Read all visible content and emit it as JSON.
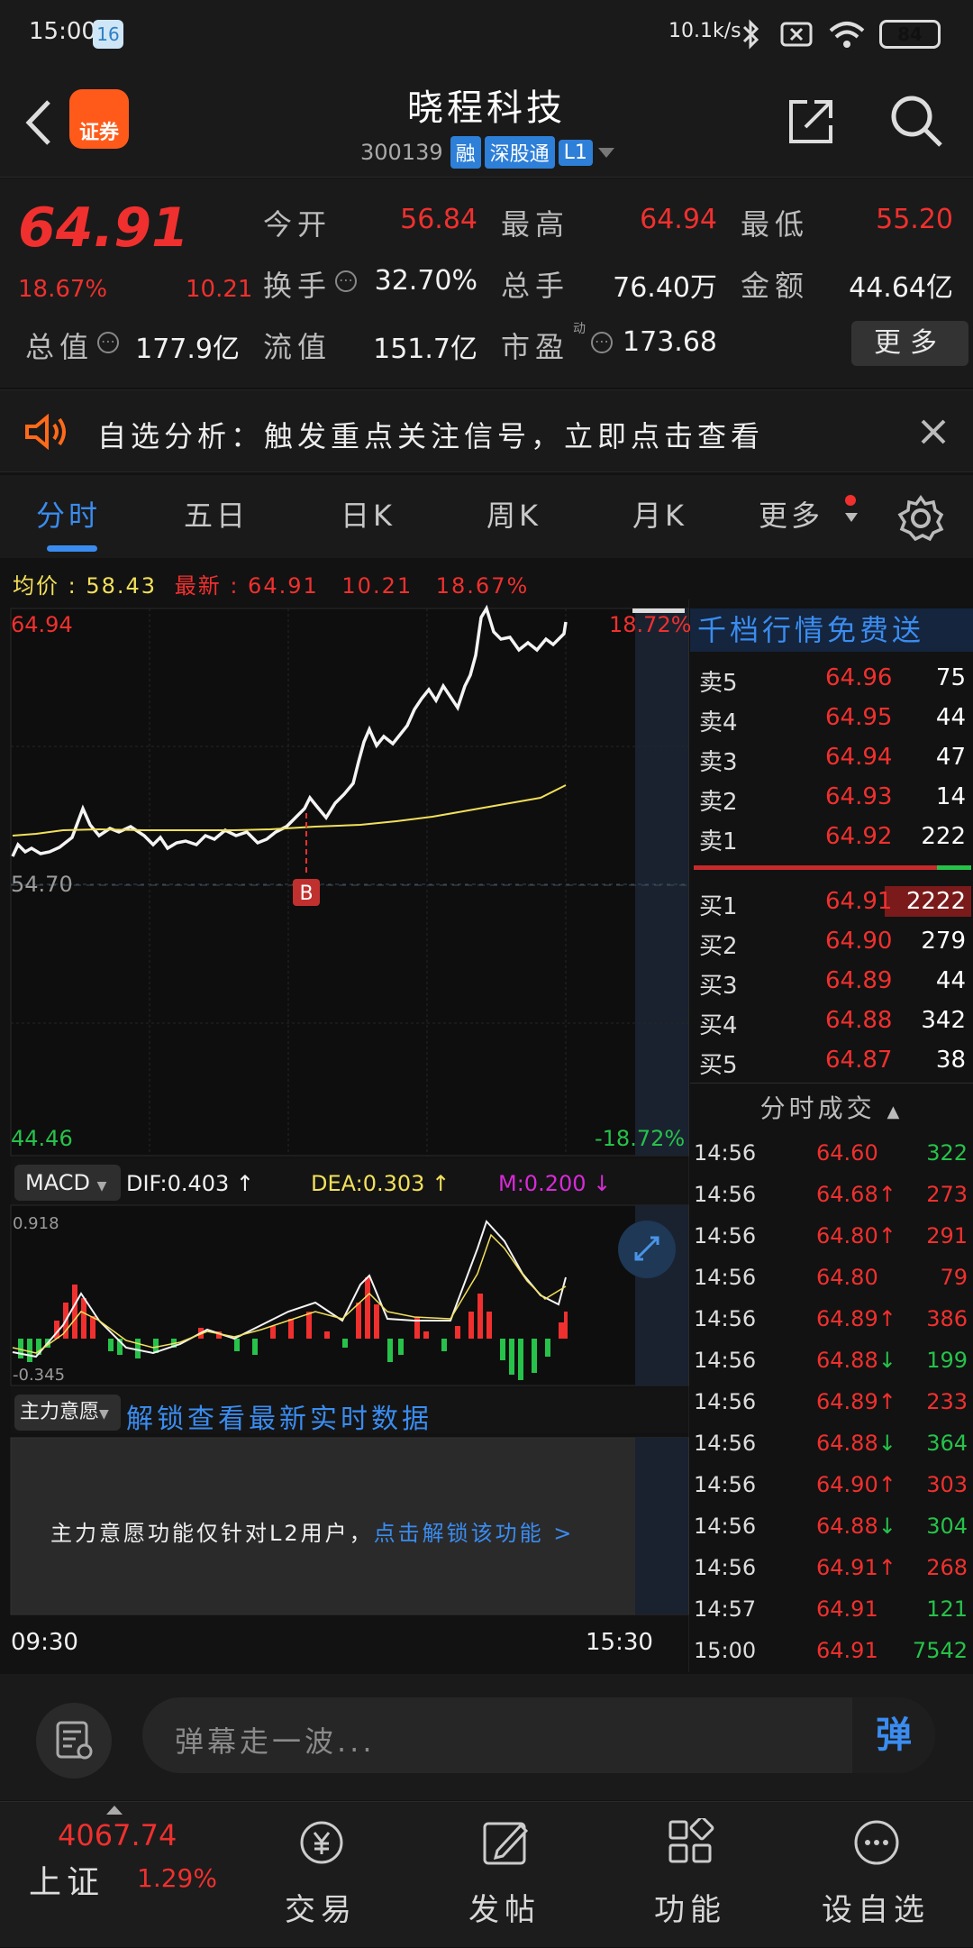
{
  "status_bar": {
    "time": "15:00",
    "notif_count": "16",
    "net_speed": "10.1k/s",
    "battery": "84"
  },
  "header": {
    "title": "晓程科技",
    "code": "300139",
    "tags": [
      "融",
      "深股通",
      "L1"
    ],
    "logo_text": "证券"
  },
  "quote": {
    "price": "64.91",
    "change_pct": "18.67%",
    "change_amt": "10.21",
    "fields": {
      "open_label": "今开",
      "open": "56.84",
      "high_label": "最高",
      "high": "64.94",
      "low_label": "最低",
      "low": "55.20",
      "turnover_label": "换手",
      "turnover": "32.70%",
      "volume_label": "总手",
      "volume": "76.40万",
      "amount_label": "金额",
      "amount": "44.64亿",
      "mcap_label": "总值",
      "mcap": "177.9亿",
      "float_label": "流值",
      "float": "151.7亿",
      "pe_label": "市盈",
      "pe_sup": "动",
      "pe": "173.68"
    },
    "more_label": "更多"
  },
  "banner": {
    "text": "自选分析：触发重点关注信号，立即点击查看"
  },
  "tabs": [
    "分时",
    "五日",
    "日K",
    "周K",
    "月K",
    "更多"
  ],
  "avg_info": {
    "avg_label": "均价",
    "avg": "58.43",
    "last_label": "最新",
    "last": "64.91",
    "chg": "10.21",
    "pct": "18.67%"
  },
  "chart": {
    "max_price": "64.94",
    "max_pct": "18.72%",
    "ref_price": "54.70",
    "min_price": "44.46",
    "min_pct": "-18.72%",
    "marker": "B",
    "time_start": "09:30",
    "time_end": "15:30"
  },
  "macd": {
    "selector": "MACD",
    "dif": "DIF:0.403",
    "dea": "DEA:0.303",
    "m": "M:0.200",
    "top": "0.918",
    "bottom": "-0.345"
  },
  "main_force": {
    "selector": "主力意愿",
    "link": "解锁查看最新实时数据",
    "notice": "主力意愿功能仅针对L2用户，",
    "unlock": "点击解锁该功能 >"
  },
  "order_book": {
    "header": "千档行情免费送",
    "asks": [
      {
        "label": "卖5",
        "price": "64.96",
        "vol": "75"
      },
      {
        "label": "卖4",
        "price": "64.95",
        "vol": "44"
      },
      {
        "label": "卖3",
        "price": "64.94",
        "vol": "47"
      },
      {
        "label": "卖2",
        "price": "64.93",
        "vol": "14"
      },
      {
        "label": "卖1",
        "price": "64.92",
        "vol": "222"
      }
    ],
    "bids": [
      {
        "label": "买1",
        "price": "64.91",
        "vol": "2222"
      },
      {
        "label": "买2",
        "price": "64.90",
        "vol": "279"
      },
      {
        "label": "买3",
        "price": "64.89",
        "vol": "44"
      },
      {
        "label": "买4",
        "price": "64.88",
        "vol": "342"
      },
      {
        "label": "买5",
        "price": "64.87",
        "vol": "38"
      }
    ],
    "ticks_title": "分时成交",
    "ticks": [
      {
        "t": "14:56",
        "p": "64.60",
        "dir": "",
        "v": "322",
        "c": "green"
      },
      {
        "t": "14:56",
        "p": "64.68",
        "dir": "↑",
        "v": "273",
        "c": "red"
      },
      {
        "t": "14:56",
        "p": "64.80",
        "dir": "↑",
        "v": "291",
        "c": "red"
      },
      {
        "t": "14:56",
        "p": "64.80",
        "dir": "",
        "v": "79",
        "c": "red"
      },
      {
        "t": "14:56",
        "p": "64.89",
        "dir": "↑",
        "v": "386",
        "c": "red"
      },
      {
        "t": "14:56",
        "p": "64.88",
        "dir": "↓",
        "v": "199",
        "c": "green"
      },
      {
        "t": "14:56",
        "p": "64.89",
        "dir": "↑",
        "v": "233",
        "c": "red"
      },
      {
        "t": "14:56",
        "p": "64.88",
        "dir": "↓",
        "v": "364",
        "c": "green"
      },
      {
        "t": "14:56",
        "p": "64.90",
        "dir": "↑",
        "v": "303",
        "c": "red"
      },
      {
        "t": "14:56",
        "p": "64.88",
        "dir": "↓",
        "v": "304",
        "c": "green"
      },
      {
        "t": "14:56",
        "p": "64.91",
        "dir": "↑",
        "v": "268",
        "c": "red"
      },
      {
        "t": "14:57",
        "p": "64.91",
        "dir": "",
        "v": "121",
        "c": "green"
      },
      {
        "t": "15:00",
        "p": "64.91",
        "dir": "",
        "v": "7542",
        "c": "green"
      }
    ]
  },
  "comment": {
    "placeholder": "弹幕走一波...",
    "send": "弹"
  },
  "bottom_nav": {
    "index_value": "4067.74",
    "index_name": "上证",
    "index_pct": "1.29%",
    "items": [
      "交易",
      "发帖",
      "功能",
      "设自选"
    ]
  },
  "colors": {
    "up": "#f0302e",
    "down": "#26c24a",
    "accent": "#3a8cf0",
    "avg_line": "#f2e05a"
  }
}
